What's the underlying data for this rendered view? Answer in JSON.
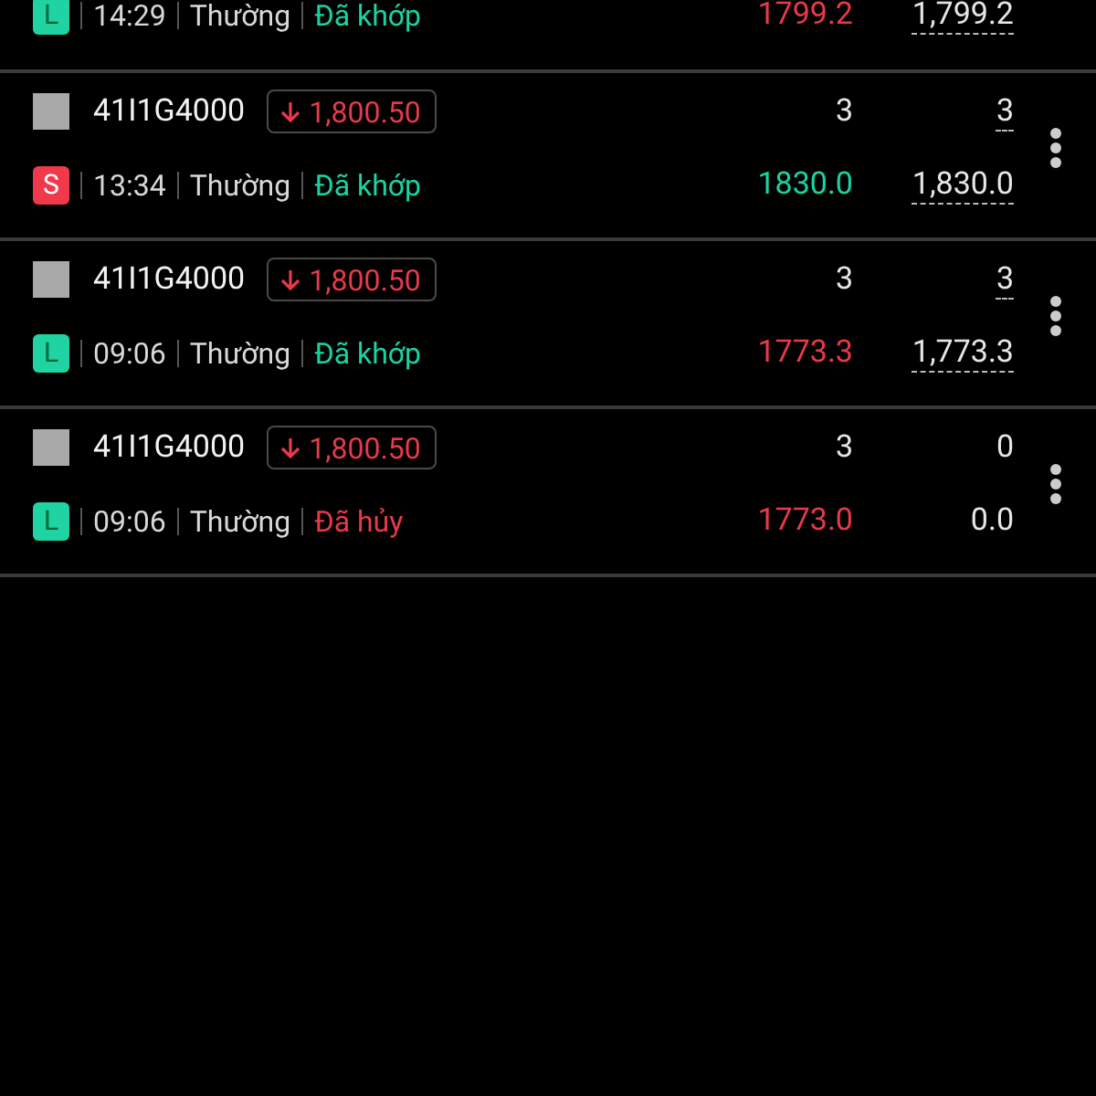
{
  "orders": [
    {
      "sell": false,
      "side_label": "L",
      "time": "14:29",
      "order_type": "Thường",
      "status": "Đã khớp",
      "cancelled": false,
      "price_up": false,
      "matched_price": "1,799.2",
      "price": "1799.2",
      "underlined": true
    },
    {
      "checked": false,
      "symbol": "41I1G4000",
      "change": "1,800.50",
      "change_up": false,
      "quantity": "3",
      "matched_quantity": "3",
      "sell": true,
      "side_label": "S",
      "time": "13:34",
      "order_type": "Thường",
      "status": "Đã khớp",
      "cancelled": false,
      "price": "1830.0",
      "price_up": true,
      "matched_price": "1,830.0",
      "underlined": true
    },
    {
      "checked": false,
      "symbol": "41I1G4000",
      "change": "1,800.50",
      "change_up": false,
      "quantity": "3",
      "matched_quantity": "3",
      "sell": false,
      "side_label": "L",
      "time": "09:06",
      "order_type": "Thường",
      "status": "Đã khớp",
      "cancelled": false,
      "price": "1773.3",
      "price_up": false,
      "matched_price": "1,773.3",
      "underlined": true
    },
    {
      "checked": false,
      "symbol": "41I1G4000",
      "change": "1,800.50",
      "change_up": false,
      "quantity": "3",
      "matched_quantity": "0",
      "sell": false,
      "side_label": "L",
      "time": "09:06",
      "order_type": "Thường",
      "status": "Đã hủy",
      "cancelled": true,
      "price": "1773.0",
      "price_up": false,
      "matched_price": "0.0",
      "underlined": false
    }
  ]
}
